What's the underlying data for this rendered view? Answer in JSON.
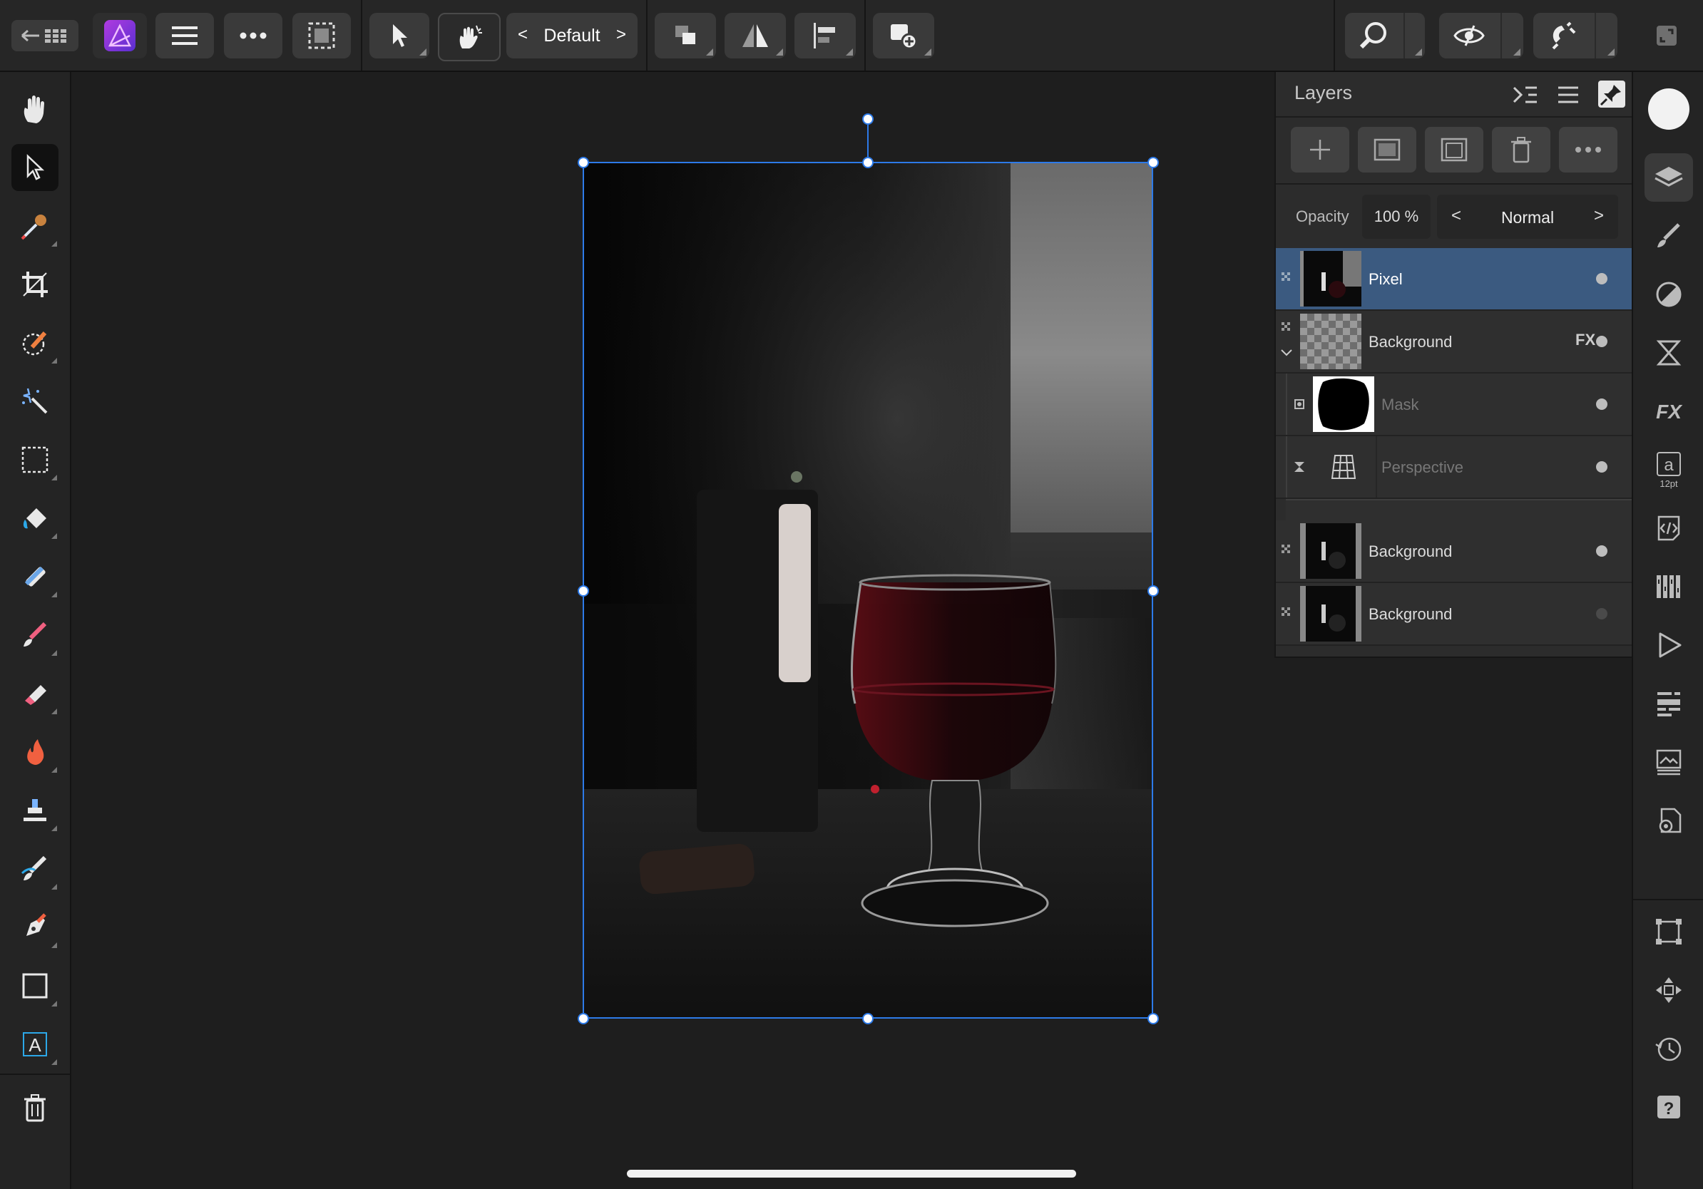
{
  "toolbar": {
    "preset": "Default",
    "preset_prev": "<",
    "preset_next": ">"
  },
  "layers": {
    "title": "Layers",
    "opacity_label": "Opacity",
    "opacity_value": "100 %",
    "blend_mode": "Normal",
    "blend_prev": "<",
    "blend_next": ">",
    "rows": [
      {
        "name": "Pixel",
        "selected": true
      },
      {
        "name": "Background",
        "fx": "FX"
      },
      {
        "name": "Mask"
      },
      {
        "name": "Perspective"
      },
      {
        "name": "Background"
      },
      {
        "name": "Background"
      }
    ]
  },
  "studio": {
    "text_size": "12pt"
  },
  "icons": {
    "top": [
      "back-to-gallery-icon",
      "affinity-photo-logo",
      "menu-icon",
      "more-icon",
      "selection-icon",
      "move-tool-icon",
      "gesture-icon",
      "arrange-icon",
      "flip-icon",
      "align-icon",
      "insert-icon",
      "zoom-icon",
      "view-mode-icon",
      "snapping-icon",
      "full-screen-icon"
    ],
    "left": [
      "hand-icon",
      "move-icon",
      "color-picker-icon",
      "crop-icon",
      "selection-brush-icon",
      "magic-wand-icon",
      "marquee-icon",
      "flood-fill-icon",
      "gradient-icon",
      "paint-brush-icon",
      "eraser-icon",
      "dodge-burn-icon",
      "clone-icon",
      "smudge-icon",
      "pen-icon",
      "rectangle-icon",
      "text-frame-icon",
      "trash-icon"
    ],
    "right": [
      "color-icon",
      "layers-icon",
      "brushes-icon",
      "adjustments-icon",
      "filters-icon",
      "fx-icon",
      "character-icon",
      "code-icon",
      "swatches-icon",
      "play-icon",
      "navigator-icon",
      "channels-icon",
      "settings-icon",
      "transform-icon",
      "move-studio-icon",
      "history-icon",
      "help-icon"
    ]
  },
  "colors": {
    "accent": "#2d7ae8",
    "selected_row": "#3b5a80",
    "app_purple": "#8a3ae0"
  }
}
